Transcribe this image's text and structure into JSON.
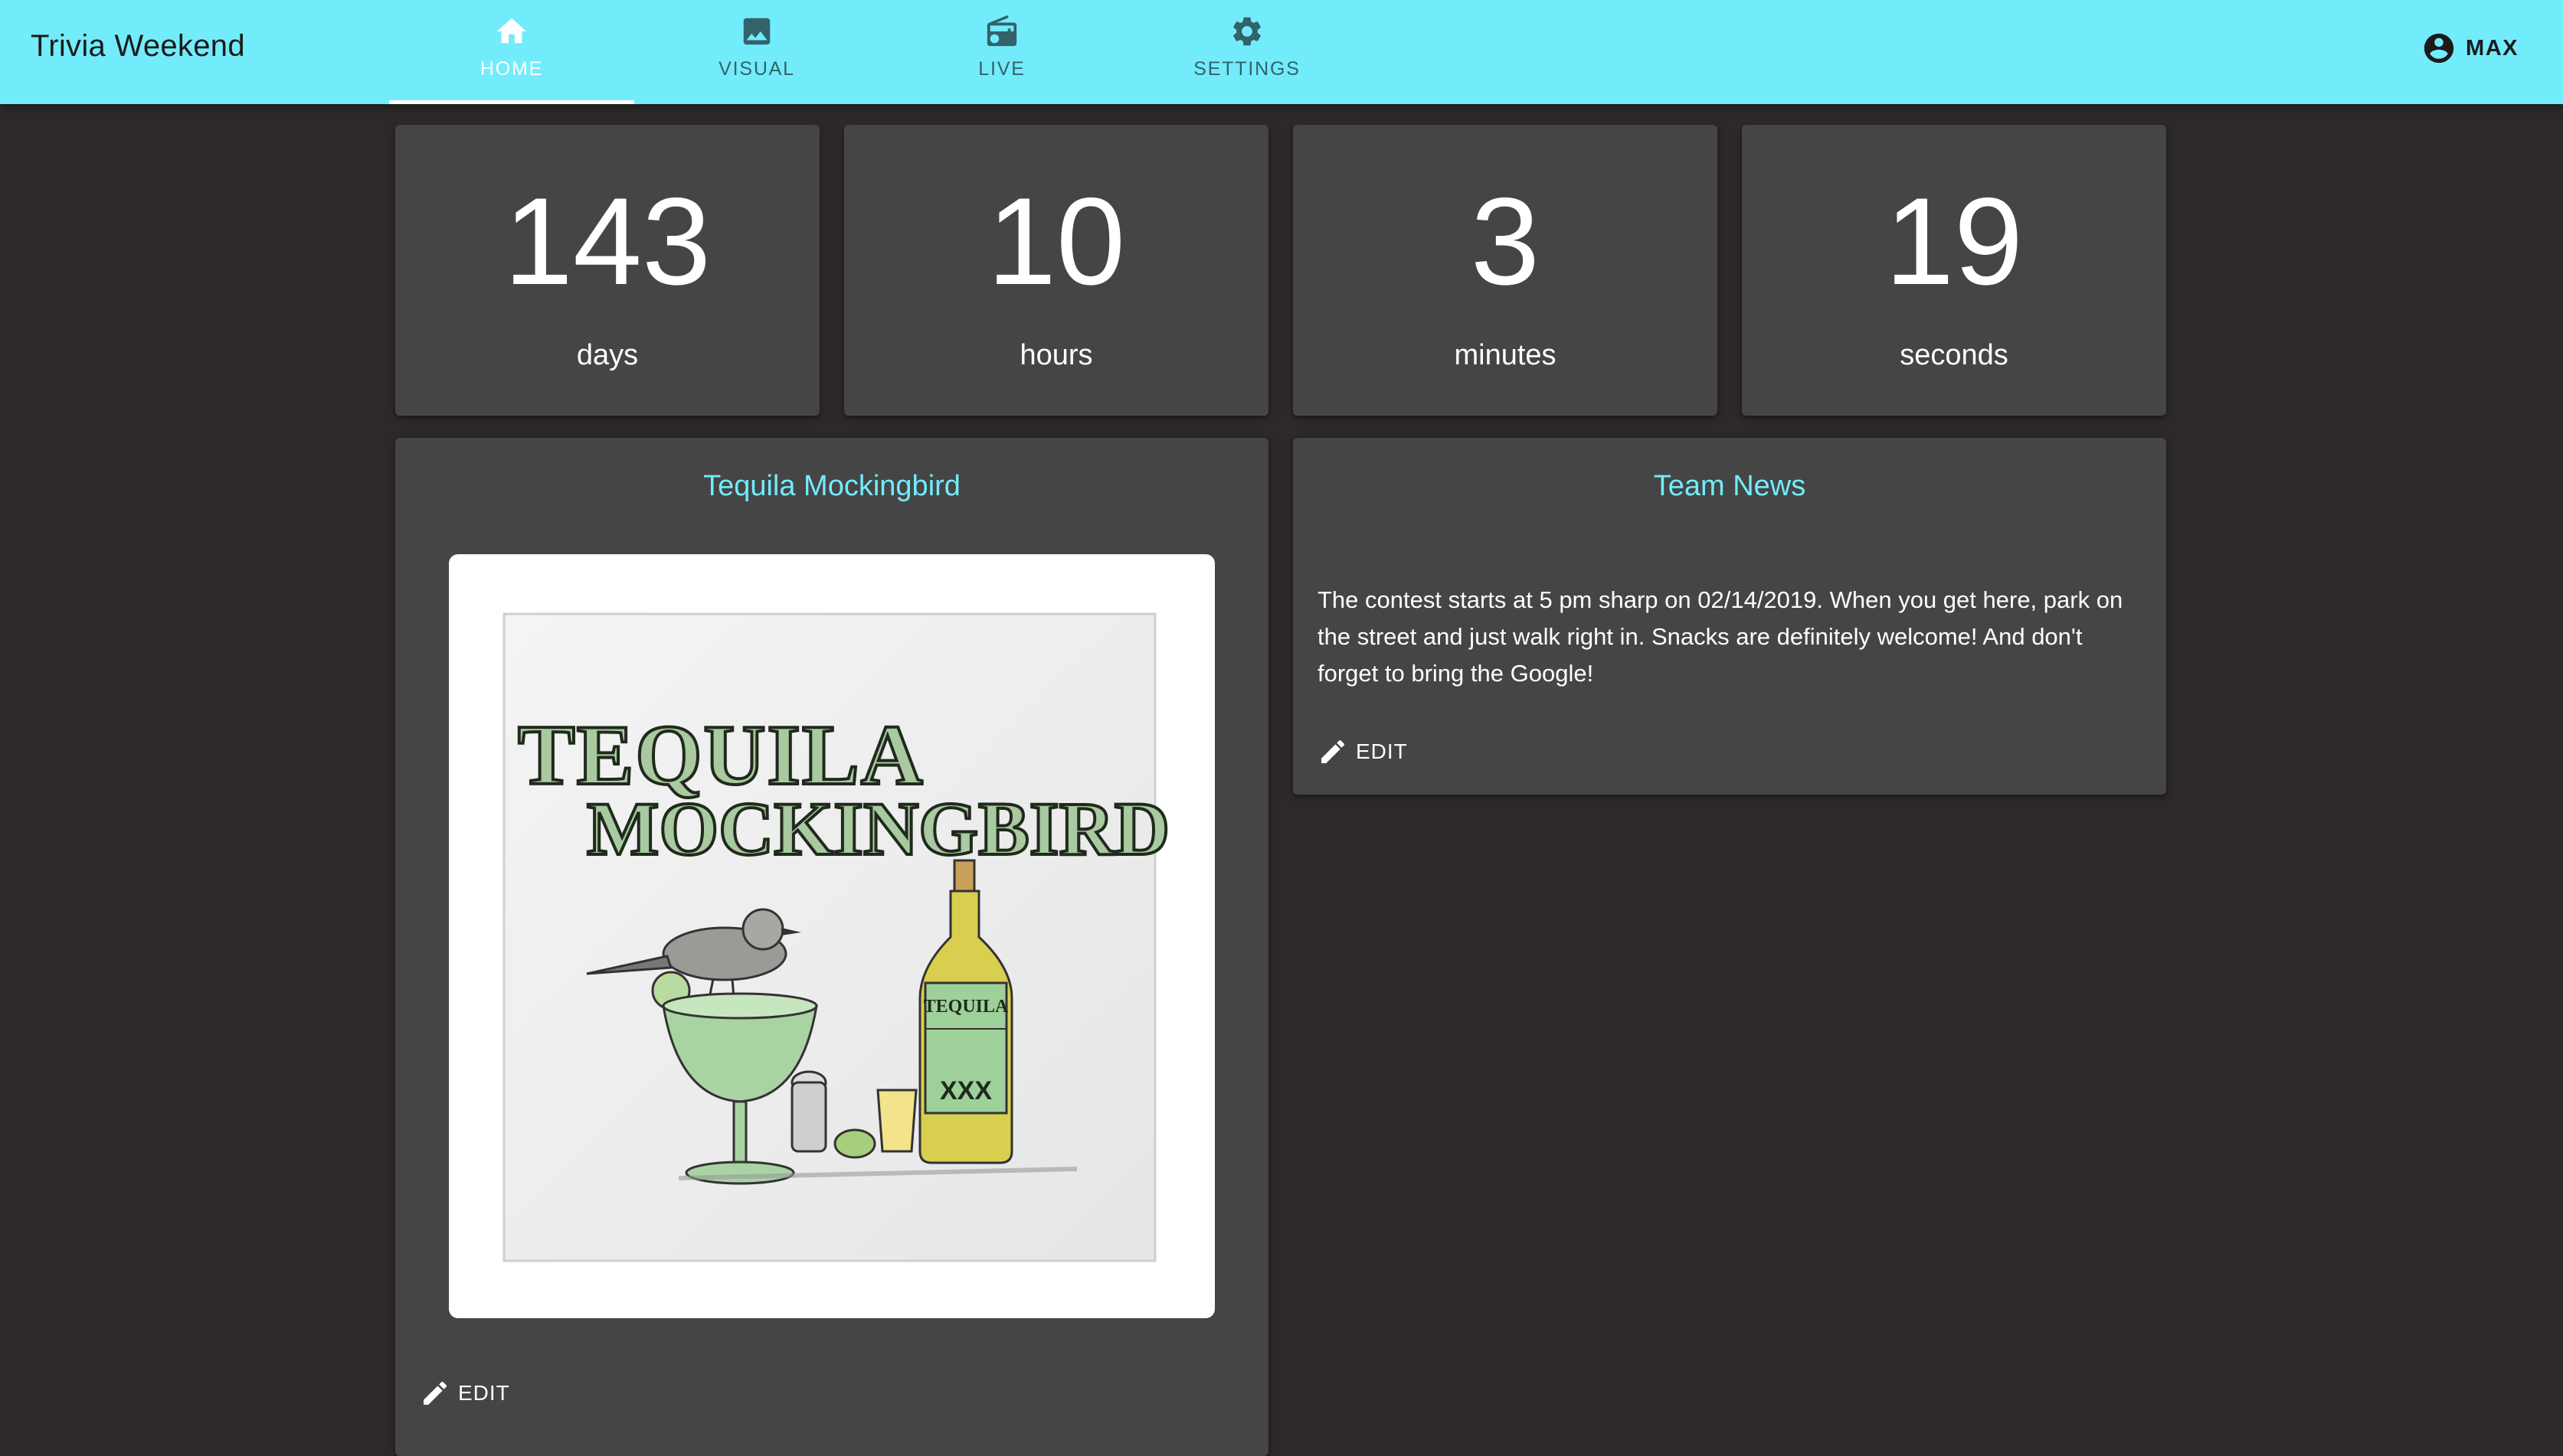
{
  "app": {
    "title": "Trivia Weekend"
  },
  "nav": {
    "tabs": [
      {
        "label": "HOME",
        "icon": "home-icon",
        "active": true
      },
      {
        "label": "VISUAL",
        "icon": "image-icon",
        "active": false
      },
      {
        "label": "LIVE",
        "icon": "radio-icon",
        "active": false
      },
      {
        "label": "SETTINGS",
        "icon": "gear-icon",
        "active": false
      }
    ]
  },
  "user": {
    "name": "MAX",
    "icon": "account-circle-icon"
  },
  "countdown": [
    {
      "value": "143",
      "unit": "days"
    },
    {
      "value": "10",
      "unit": "hours"
    },
    {
      "value": "3",
      "unit": "minutes"
    },
    {
      "value": "19",
      "unit": "seconds"
    }
  ],
  "team": {
    "title": "Tequila Mockingbird",
    "logo_text": [
      "TEQUILA",
      "MOCKINGBIRD"
    ],
    "bottle_text": [
      "TEQUILA",
      "XXX"
    ],
    "edit_label": "EDIT"
  },
  "news": {
    "title": "Team News",
    "body": "The contest starts at 5 pm sharp on 02/14/2019. When you get here, park on the street and just walk right in. Snacks are definitely welcome! And don't forget to bring the Google!",
    "edit_label": "EDIT"
  },
  "colors": {
    "accent": "#72ecfb",
    "background": "#2c2928",
    "card": "#454545",
    "tab_inactive": "#33626a"
  }
}
